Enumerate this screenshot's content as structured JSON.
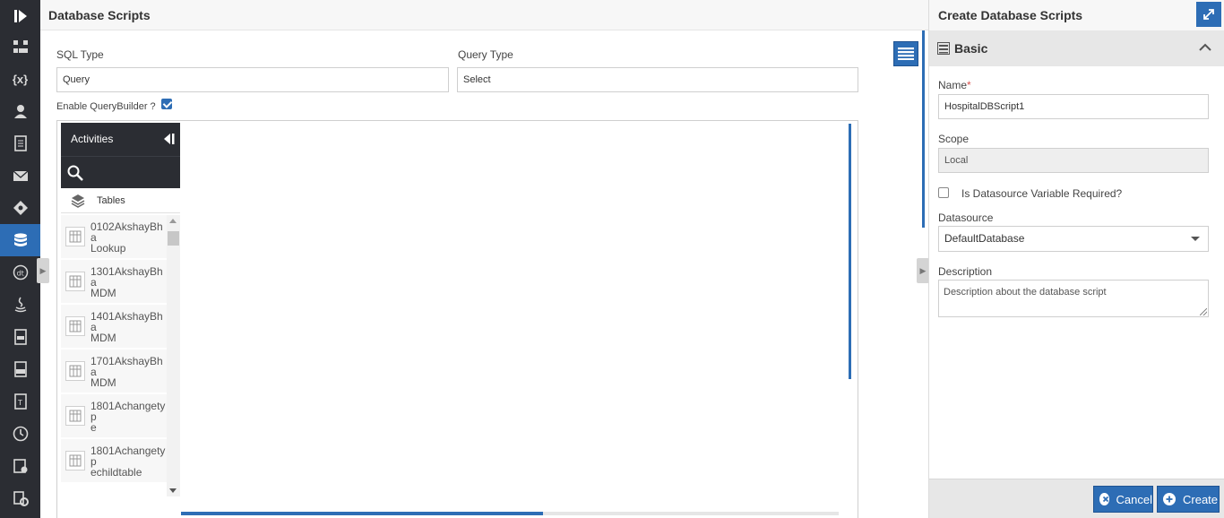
{
  "app": {
    "nav_items": [
      {
        "icon": "logo-play-icon"
      },
      {
        "icon": "workflow-icon"
      },
      {
        "icon": "variables-icon",
        "text": "{x}"
      },
      {
        "icon": "user-icon"
      },
      {
        "icon": "document-icon"
      },
      {
        "icon": "mail-icon"
      },
      {
        "icon": "decision-icon"
      },
      {
        "icon": "database-icon",
        "active": true
      },
      {
        "icon": "dt-icon"
      },
      {
        "icon": "java-icon"
      },
      {
        "icon": "file-icon"
      },
      {
        "icon": "csv-icon"
      },
      {
        "icon": "text-file-icon"
      },
      {
        "icon": "clock-icon"
      },
      {
        "icon": "report-icon"
      },
      {
        "icon": "settings-icon"
      }
    ],
    "colors": {
      "accent": "#2d6db5",
      "rail": "#2b2d33",
      "required": "#d9534f"
    }
  },
  "main": {
    "title": "Database Scripts",
    "sql_type": {
      "label": "SQL Type",
      "value": "Query"
    },
    "query_type": {
      "label": "Query Type",
      "value": "Select"
    },
    "enable_querybuilder": {
      "label": "Enable QueryBuilder ?",
      "checked": true
    }
  },
  "activities": {
    "title": "Activities",
    "tables_label": "Tables",
    "tables": [
      {
        "name": "0102AkshayBha\nLookup"
      },
      {
        "name": "1301AkshayBha\nMDM"
      },
      {
        "name": "1401AkshayBha\nMDM"
      },
      {
        "name": "1701AkshayBha\nMDM"
      },
      {
        "name": "1801Achangetyp\ne"
      },
      {
        "name": "1801Achangetyp\nechildtable"
      }
    ]
  },
  "panel": {
    "title": "Create Database Scripts",
    "section": "Basic",
    "name": {
      "label": "Name",
      "required_mark": "*",
      "value": "HospitalDBScript1"
    },
    "scope": {
      "label": "Scope",
      "value": "Local"
    },
    "datasource_variable": {
      "label": "Is Datasource Variable Required?",
      "checked": false
    },
    "datasource": {
      "label": "Datasource",
      "value": "DefaultDatabase"
    },
    "description": {
      "label": "Description",
      "placeholder": "Description about the database script"
    },
    "buttons": {
      "cancel": "Cancel",
      "create": "Create"
    }
  }
}
